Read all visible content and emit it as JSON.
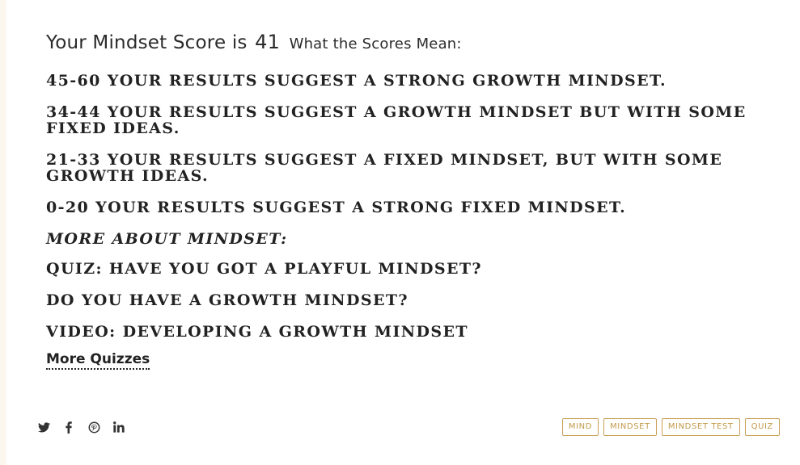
{
  "result": {
    "score_prefix": "Your Mindset Score is",
    "score_value": "41",
    "scores_mean_label": "What the Scores Mean:"
  },
  "score_ranges": [
    {
      "text": "45-60 YOUR RESULTS SUGGEST A STRONG GROWTH MINDSET."
    },
    {
      "text": "34-44 YOUR RESULTS SUGGEST A GROWTH MINDSET BUT WITH SOME FIXED IDEAS."
    },
    {
      "text": "21-33 YOUR RESULTS SUGGEST A FIXED MINDSET, BUT WITH SOME GROWTH IDEAS."
    },
    {
      "text": "0-20 YOUR RESULTS SUGGEST A STRONG FIXED MINDSET."
    }
  ],
  "more_about": {
    "heading": "MORE ABOUT MINDSET:",
    "links": [
      {
        "text": "QUIZ: HAVE YOU GOT A PLAYFUL MINDSET?"
      },
      {
        "text": "DO YOU HAVE A GROWTH MINDSET?"
      },
      {
        "text": "VIDEO: DEVELOPING A GROWTH MINDSET"
      }
    ]
  },
  "more_quizzes_label": "More Quizzes",
  "share": {
    "icons": [
      "twitter-icon",
      "facebook-icon",
      "pinterest-icon",
      "linkedin-icon"
    ]
  },
  "tags": [
    "MIND",
    "MINDSET",
    "MINDSET TEST",
    "QUIZ"
  ],
  "colors": {
    "text": "#222222",
    "tag_accent": "#c49a4a",
    "left_edge": "#fbf7ef"
  }
}
